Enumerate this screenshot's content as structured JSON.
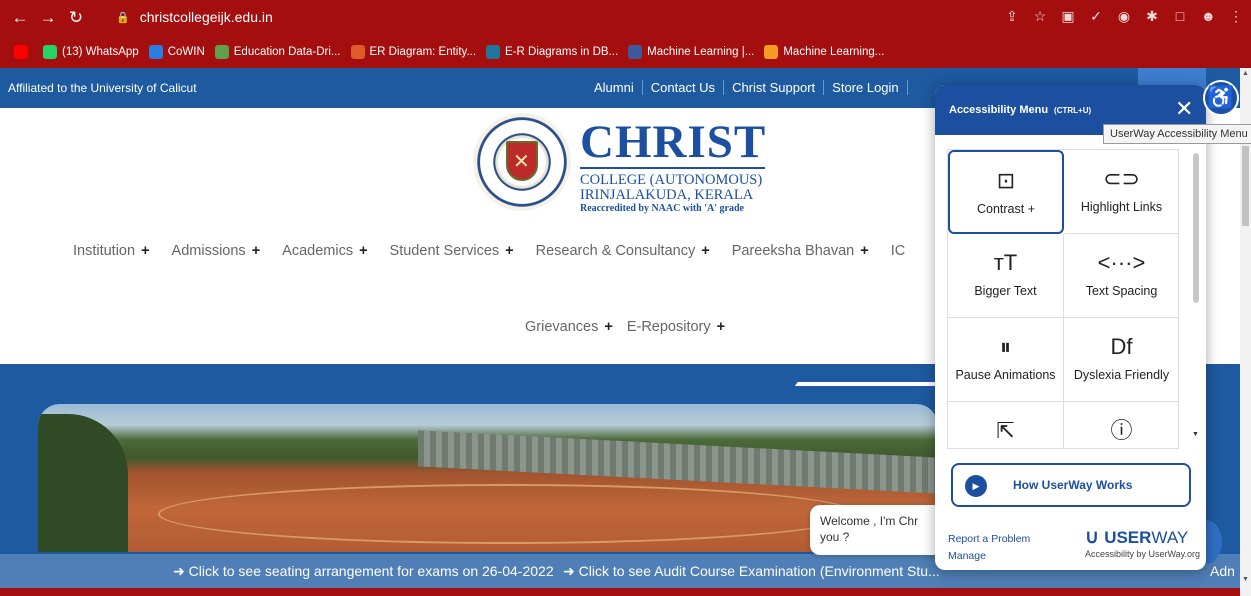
{
  "browser": {
    "url": "christcollegeijk.edu.in",
    "bookmarks": [
      {
        "label": "",
        "color": "#ff0000",
        "icon": "youtube-icon"
      },
      {
        "label": "(13) WhatsApp",
        "color": "#25d366",
        "icon": "whatsapp-icon"
      },
      {
        "label": "CoWIN",
        "color": "#2a7de1",
        "icon": "cowin-icon"
      },
      {
        "label": "Education Data-Dri...",
        "color": "#5fa04e",
        "icon": "edu-icon"
      },
      {
        "label": "ER Diagram: Entity...",
        "color": "#e05a2a",
        "icon": "er-icon"
      },
      {
        "label": "E-R Diagrams in DB...",
        "color": "#21759b",
        "icon": "wordpress-icon"
      },
      {
        "label": "Machine Learning |...",
        "color": "#3b5998",
        "icon": "ml-icon"
      },
      {
        "label": "Machine Learning...",
        "color": "#f59b23",
        "icon": "e-icon"
      }
    ]
  },
  "site": {
    "affiliation": "Affiliated to the University of Calicut",
    "top_links": [
      "Alumni",
      "Contact Us",
      "Christ Support",
      "Store Login"
    ],
    "brand": {
      "name": "CHRIST",
      "line1": "COLLEGE (AUTONOMOUS)",
      "line2": "IRINJALAKUDA, KERALA",
      "accreditation": "Reaccredited by NAAC with 'A' grade"
    },
    "menu": [
      "Institution",
      "Admissions",
      "Academics",
      "Student Services",
      "Research & Consultancy",
      "Pareeksha Bhavan",
      "IC"
    ],
    "menu2": [
      "Grievances",
      "E-Repository"
    ],
    "ticker": [
      "Click to see seating arrangement for exams on 26-04-2022",
      "Click to see Audit Course Examination (Environment Stu..."
    ],
    "ticker_tail": "Adn",
    "chat_text": "Welcome , I'm Chr you ?"
  },
  "tooltip": "UserWay Accessibility Menu",
  "accessibility_panel": {
    "title": "Accessibility Menu",
    "shortcut": "(CTRL+U)",
    "tiles": [
      {
        "label": "Contrast +",
        "icon": "contrast-icon",
        "glyph": "⊡",
        "selected": true
      },
      {
        "label": "Highlight Links",
        "icon": "link-icon",
        "glyph": "⊂⊃",
        "selected": false
      },
      {
        "label": "Bigger Text",
        "icon": "bigger-text-icon",
        "glyph": "ᴛT",
        "selected": false
      },
      {
        "label": "Text Spacing",
        "icon": "text-spacing-icon",
        "glyph": "<···>",
        "selected": false
      },
      {
        "label": "Pause Animations",
        "icon": "pause-icon",
        "glyph": "⏸",
        "selected": false
      },
      {
        "label": "Dyslexia Friendly",
        "icon": "dyslexia-icon",
        "glyph": "Df",
        "selected": false
      },
      {
        "label": "",
        "icon": "cursor-icon",
        "glyph": "⇱",
        "selected": false
      },
      {
        "label": "",
        "icon": "tooltip-icon",
        "glyph": "ⓘ",
        "selected": false
      }
    ],
    "how_label": "How UserWay Works",
    "report": "Report a Problem",
    "manage": "Manage",
    "logo_bold": "USER",
    "logo_light": "WAY",
    "by": "Accessibility by UserWay.org"
  }
}
